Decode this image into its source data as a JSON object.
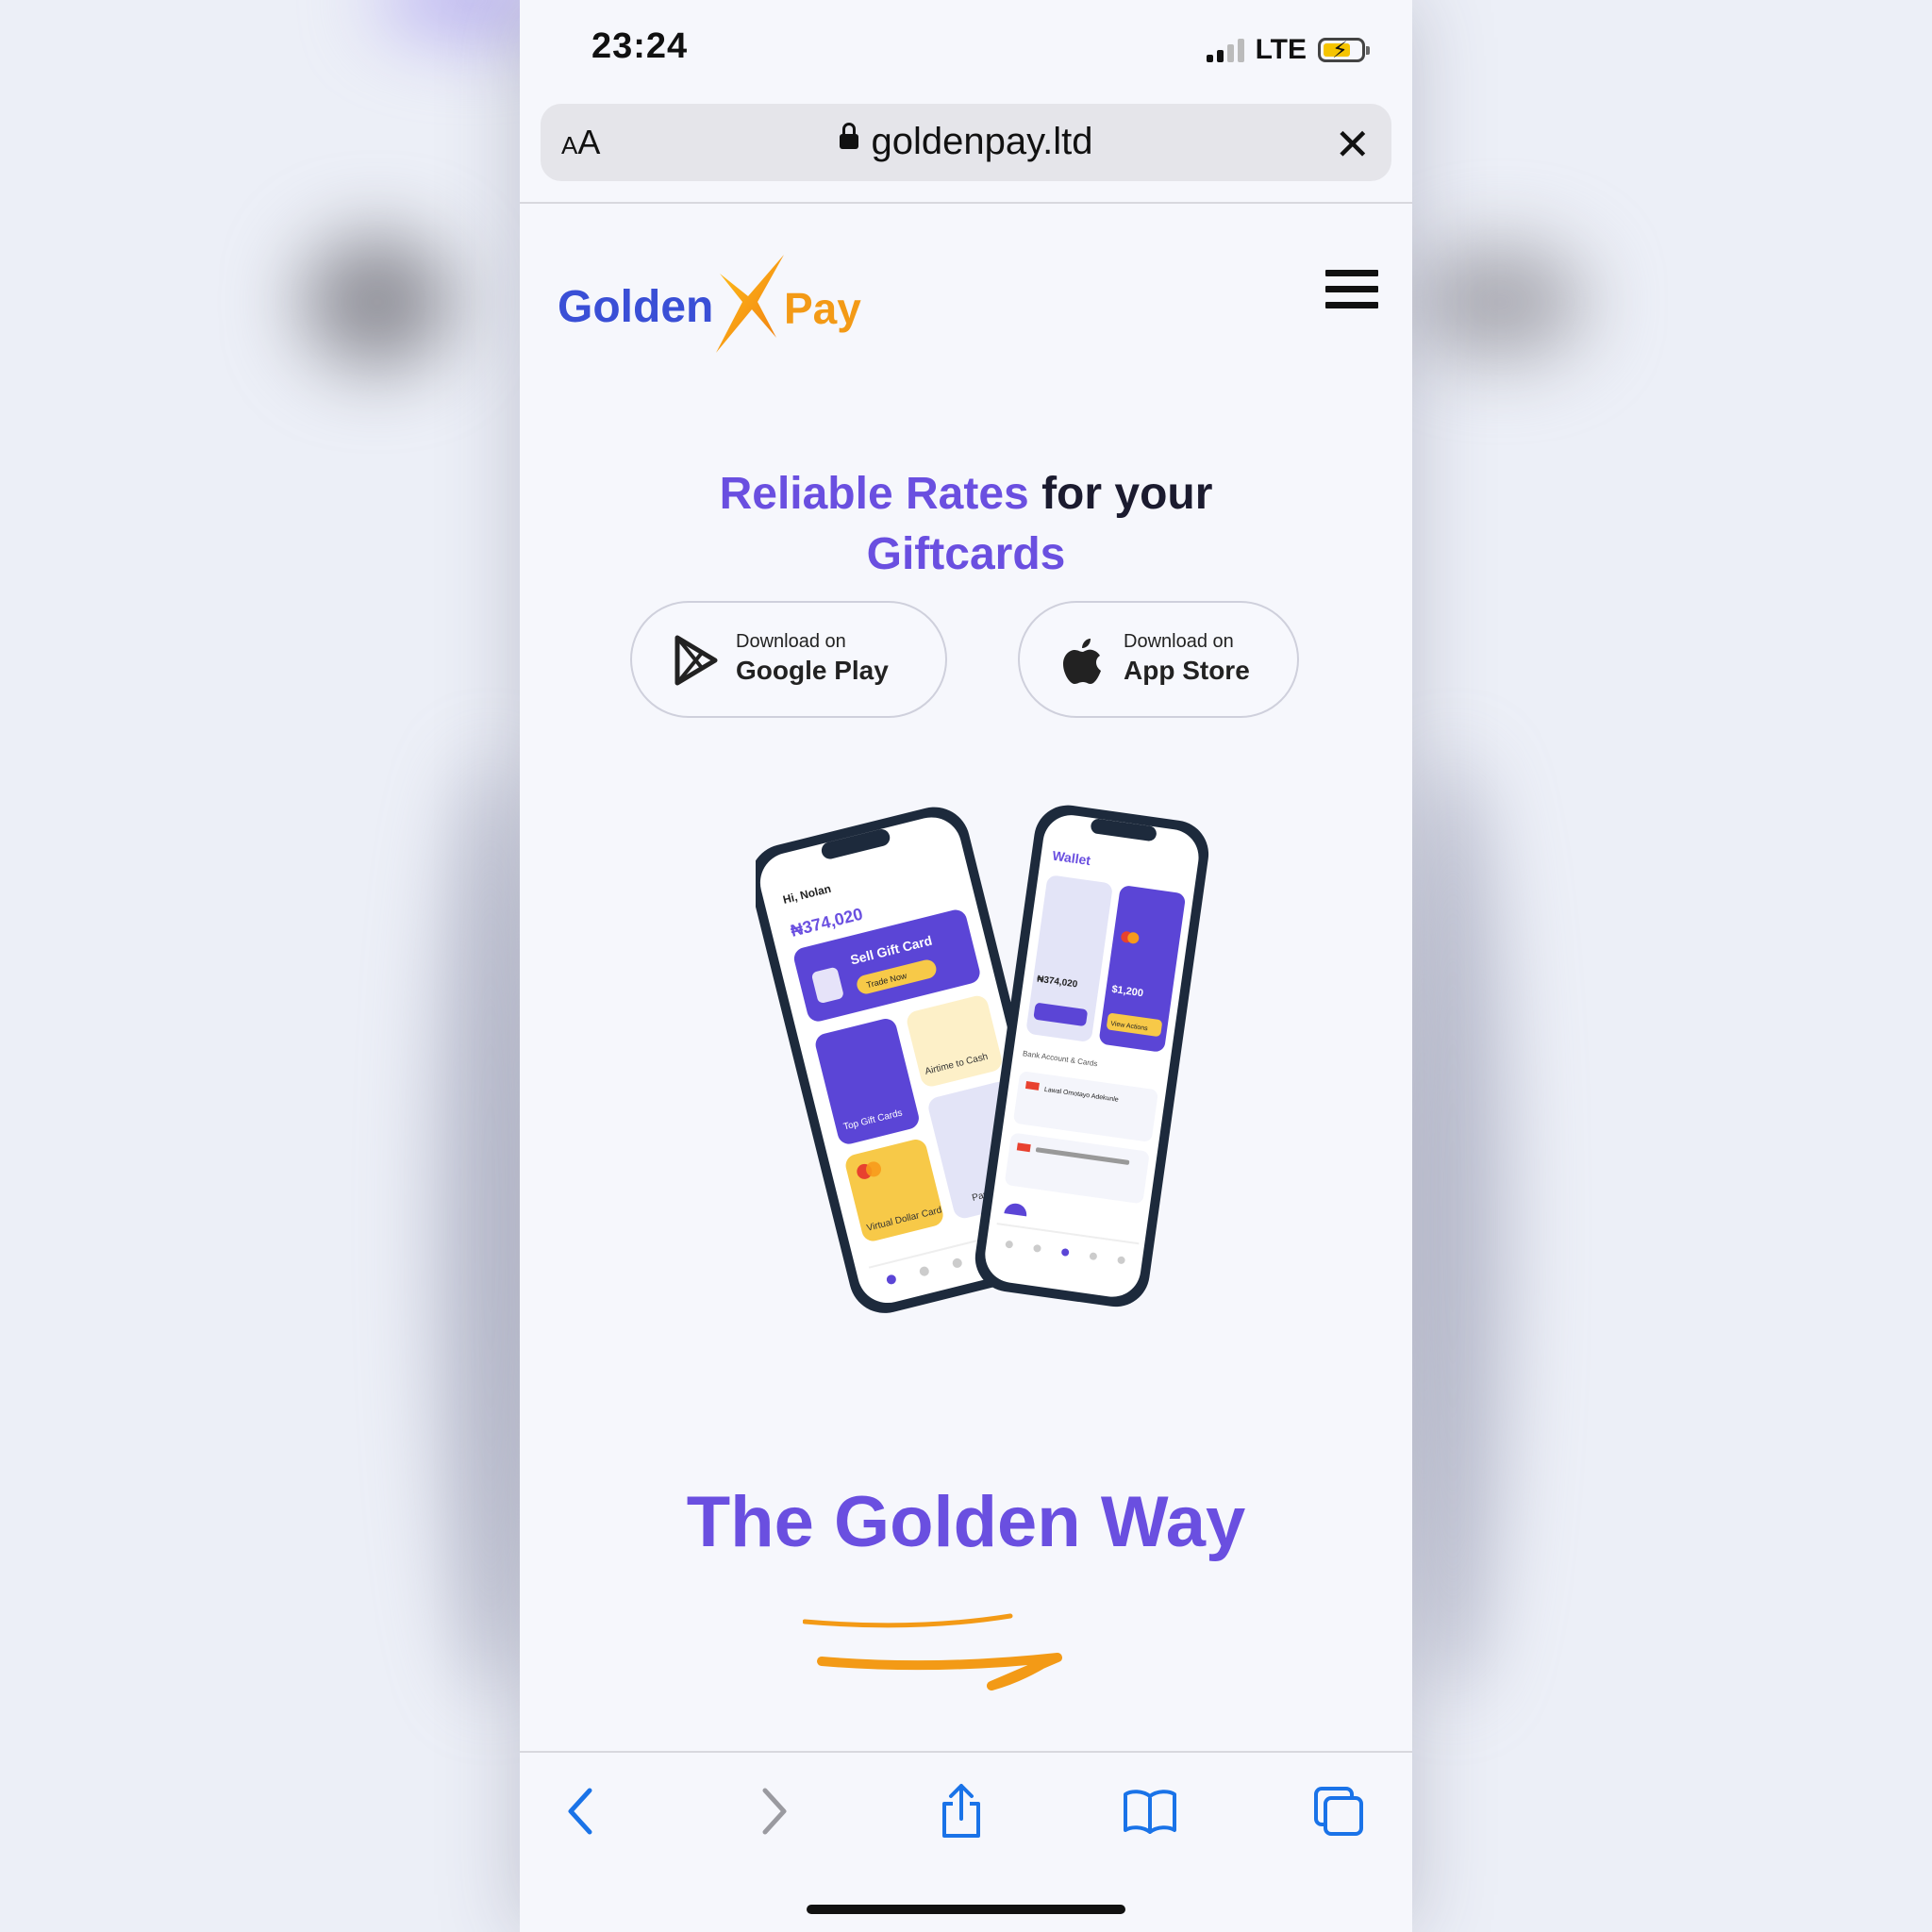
{
  "status_bar": {
    "time": "23:24",
    "network": "LTE"
  },
  "address_bar": {
    "text_size_label": "AA",
    "url": "goldenpay.ltd"
  },
  "site": {
    "logo_left": "Golden",
    "logo_right": "Pay",
    "headline": {
      "accent1": "Reliable Rates",
      "plain": " for your",
      "accent2": "Giftcards"
    },
    "google_play": {
      "small": "Download on",
      "big": "Google Play"
    },
    "app_store": {
      "small": "Download on",
      "big": "App Store"
    },
    "mockup": {
      "greeting": "Hi, Nolan",
      "balance": "₦374,020",
      "sell_card": "Sell Gift Card",
      "trade_now": "Trade Now",
      "airtime": "Airtime to Cash",
      "top_gift": "Top Gift Cards",
      "virtual_card": "Virtual Dollar Card",
      "pay_bills": "Pay Bills",
      "wallet_title": "Wallet",
      "wallet_naira": "₦374,020",
      "wallet_dollar": "$1,200",
      "view_actions": "View Actions",
      "bank_title": "Bank Account & Cards",
      "account_name": "Lawal Omotayo Adekunle"
    },
    "section_title": "The Golden Way"
  },
  "colors": {
    "accent": "#6a4fe0",
    "brand_blue": "#3a4fd6",
    "brand_orange": "#f39a16"
  }
}
